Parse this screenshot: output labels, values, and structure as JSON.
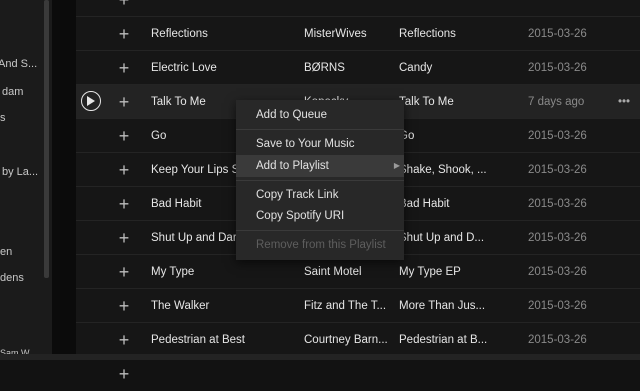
{
  "sidebar": {
    "items": [
      {
        "label": "And S..."
      },
      {
        "label": "dam"
      },
      {
        "label": "s"
      },
      {
        "label": "by La..."
      },
      {
        "label": "en"
      },
      {
        "label": "dens"
      },
      {
        "label": "Sam W..."
      }
    ]
  },
  "tracks": [
    {
      "title": "",
      "artist": "",
      "album": "",
      "added": "",
      "partial": true
    },
    {
      "title": "Reflections",
      "artist": "MisterWives",
      "album": "Reflections",
      "added": "2015-03-26"
    },
    {
      "title": "Electric Love",
      "artist": "BØRNS",
      "album": "Candy",
      "added": "2015-03-26"
    },
    {
      "title": "Talk To Me",
      "artist": "Kopecky",
      "album": "Talk To Me",
      "added": "7 days ago",
      "hovered": true
    },
    {
      "title": "Go",
      "artist": "",
      "album": "Go",
      "added": "2015-03-26"
    },
    {
      "title": "Keep Your Lips S...",
      "artist": "",
      "album": "Shake, Shook, ...",
      "added": "2015-03-26"
    },
    {
      "title": "Bad Habit",
      "artist": "",
      "album": "Bad Habit",
      "added": "2015-03-26"
    },
    {
      "title": "Shut Up and Dar...",
      "artist": "",
      "album": "Shut Up and D...",
      "added": "2015-03-26"
    },
    {
      "title": "My Type",
      "artist": "Saint Motel",
      "album": "My Type EP",
      "added": "2015-03-26"
    },
    {
      "title": "The Walker",
      "artist": "Fitz and The T...",
      "album": "More Than Jus...",
      "added": "2015-03-26"
    },
    {
      "title": "Pedestrian at Best",
      "artist": "Courtney Barn...",
      "album": "Pedestrian at B...",
      "added": "2015-03-26"
    },
    {
      "title": "",
      "artist": "",
      "album": "",
      "added": "",
      "partial": true
    }
  ],
  "row_icons": {
    "add": "+",
    "more": "•••"
  },
  "context_menu": {
    "add_to_queue": "Add to Queue",
    "save_to_music": "Save to Your Music",
    "add_to_playlist": "Add to Playlist",
    "submenu_arrow": "▶",
    "copy_track_link": "Copy Track Link",
    "copy_spotify_uri": "Copy Spotify URI",
    "remove_from_playlist": "Remove from this Playlist"
  }
}
